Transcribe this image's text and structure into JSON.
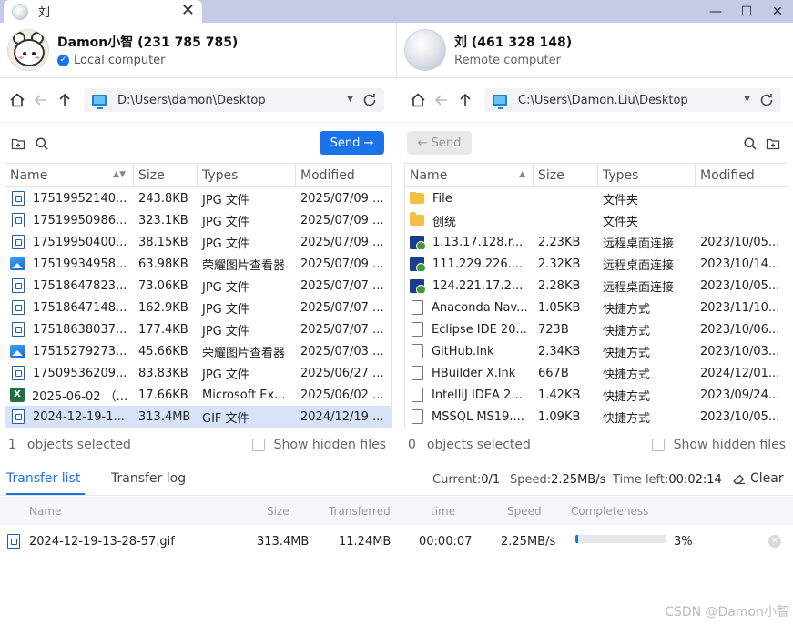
{
  "window": {
    "tab_title": "刘",
    "close_glyph": "✕",
    "minimize_glyph": "—",
    "maximize_glyph": "☐",
    "exit_glyph": "✕"
  },
  "local": {
    "name": "Damon小智 (231 785 785)",
    "subtitle": "Local computer",
    "path": "D:\\Users\\damon\\Desktop",
    "send_label": "Send →",
    "columns": [
      "Name",
      "Size",
      "Types",
      "Modified"
    ],
    "files": [
      {
        "icon": "doc",
        "name": "17519952140...",
        "size": "243.8KB",
        "type": "JPG 文件",
        "modified": "2025/07/09 ..."
      },
      {
        "icon": "doc",
        "name": "17519950986...",
        "size": "323.1KB",
        "type": "JPG 文件",
        "modified": "2025/07/09 ..."
      },
      {
        "icon": "doc",
        "name": "17519950400...",
        "size": "38.15KB",
        "type": "JPG 文件",
        "modified": "2025/07/09 ..."
      },
      {
        "icon": "img",
        "name": "17519934958...",
        "size": "63.98KB",
        "type": "荣耀图片查看器",
        "modified": "2025/07/09 ..."
      },
      {
        "icon": "doc",
        "name": "17518647823...",
        "size": "73.06KB",
        "type": "JPG 文件",
        "modified": "2025/07/07 ..."
      },
      {
        "icon": "doc",
        "name": "17518647148...",
        "size": "162.9KB",
        "type": "JPG 文件",
        "modified": "2025/07/07 ..."
      },
      {
        "icon": "doc",
        "name": "17518638037...",
        "size": "177.4KB",
        "type": "JPG 文件",
        "modified": "2025/07/07 ..."
      },
      {
        "icon": "img",
        "name": "17515279273...",
        "size": "45.66KB",
        "type": "荣耀图片查看器",
        "modified": "2025/07/03 ..."
      },
      {
        "icon": "doc",
        "name": "17509536209...",
        "size": "83.83KB",
        "type": "JPG 文件",
        "modified": "2025/06/27 ..."
      },
      {
        "icon": "xls",
        "name": "2025-06-02 （...",
        "size": "17.66KB",
        "type": "Microsoft Ex...",
        "modified": "2025/06/02 ..."
      },
      {
        "icon": "doc",
        "name": "2024-12-19-1...",
        "size": "313.4MB",
        "type": "GIF 文件",
        "modified": "2024/12/19 ...",
        "selected": true
      }
    ],
    "selected_count": "1",
    "selected_label": "objects selected",
    "hidden_label": "Show hidden files"
  },
  "remote": {
    "name": "刘 (461 328 148)",
    "subtitle": "Remote computer",
    "path": "C:\\Users\\Damon.Liu\\Desktop",
    "send_label": "← Send",
    "columns": [
      "Name",
      "Size",
      "Types",
      "Modified"
    ],
    "files": [
      {
        "icon": "folder",
        "name": "File",
        "size": "",
        "type": "文件夹",
        "modified": ""
      },
      {
        "icon": "folder",
        "name": "创统",
        "size": "",
        "type": "文件夹",
        "modified": ""
      },
      {
        "icon": "rdp",
        "name": "1.13.17.128.r...",
        "size": "2.23KB",
        "type": "远程桌面连接",
        "modified": "2023/10/05..."
      },
      {
        "icon": "rdp",
        "name": "111.229.226....",
        "size": "2.32KB",
        "type": "远程桌面连接",
        "modified": "2023/10/14..."
      },
      {
        "icon": "rdp",
        "name": "124.221.17.2...",
        "size": "2.28KB",
        "type": "远程桌面连接",
        "modified": "2023/10/05..."
      },
      {
        "icon": "lnk",
        "name": "Anaconda Nav...",
        "size": "1.05KB",
        "type": "快捷方式",
        "modified": "2023/11/10..."
      },
      {
        "icon": "lnk",
        "name": "Eclipse IDE 20...",
        "size": "723B",
        "type": "快捷方式",
        "modified": "2023/10/06..."
      },
      {
        "icon": "lnk",
        "name": "GitHub.lnk",
        "size": "2.34KB",
        "type": "快捷方式",
        "modified": "2023/10/03..."
      },
      {
        "icon": "lnk",
        "name": "HBuilder X.lnk",
        "size": "667B",
        "type": "快捷方式",
        "modified": "2024/12/01..."
      },
      {
        "icon": "lnk",
        "name": "IntelliJ IDEA 2...",
        "size": "1.42KB",
        "type": "快捷方式",
        "modified": "2023/09/24..."
      },
      {
        "icon": "lnk",
        "name": "MSSQL MS19....",
        "size": "1.09KB",
        "type": "快捷方式",
        "modified": "2023/10/05..."
      }
    ],
    "selected_count": "0",
    "selected_label": "objects selected",
    "hidden_label": "Show hidden files"
  },
  "transfer": {
    "tab_list": "Transfer list",
    "tab_log": "Transfer log",
    "current_label": "Current:",
    "current_value": "0/1",
    "speed_label": "Speed:",
    "speed_value": "2.25MB/s",
    "time_left_label": "Time left:",
    "time_left_value": "00:02:14",
    "clear_label": "Clear",
    "columns": {
      "name": "Name",
      "size": "Size",
      "transferred": "Transferred",
      "time": "time",
      "speed": "Speed",
      "completeness": "Completeness"
    },
    "rows": [
      {
        "name": "2024-12-19-13-28-57.gif",
        "size": "313.4MB",
        "transferred": "11.24MB",
        "time": "00:00:07",
        "speed": "2.25MB/s",
        "percent_label": "3%",
        "progress": 0.03
      }
    ]
  },
  "watermark": "CSDN @Damon小智",
  "colors": {
    "accent": "#1a73e8",
    "titlebar": "#c5cbe7",
    "selected_row": "#d7e3f8"
  }
}
